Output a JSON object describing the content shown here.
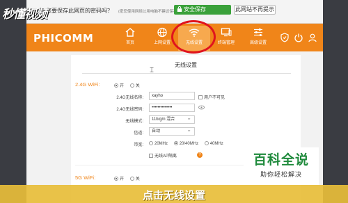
{
  "watermark": {
    "site": "秒懂视频"
  },
  "password_bar": {
    "question": "您要保存此网页的密码吗？",
    "note": "(密您使用网络公用电脑不建议保存)",
    "save_label": "安全保存",
    "never_label": "此网站不再提示"
  },
  "header": {
    "logo": "PHICOMM",
    "nav": [
      {
        "label": "首页",
        "icon": "home-icon"
      },
      {
        "label": "上网设置",
        "icon": "globe-icon"
      },
      {
        "label": "无线设置",
        "icon": "wifi-icon",
        "active": true
      },
      {
        "label": "终端管理",
        "icon": "monitor-icon"
      },
      {
        "label": "高级设置",
        "icon": "sliders-icon"
      }
    ],
    "right_icons": [
      "shield-icon",
      "power-icon",
      "user-icon"
    ],
    "accent": "#f08519",
    "highlight": "#e0141e"
  },
  "panel": {
    "title": "无线设置",
    "wifi24": {
      "section_label": "2.4G WiFi:",
      "on_label": "开",
      "off_label": "关",
      "selected": "on",
      "fields": {
        "name_label": "2.4G无线名称:",
        "name_value": "xayho",
        "hide_label": "用户不可见",
        "password_label": "2.4G无线密码:",
        "password_value": "••••••••••••••",
        "mode_label": "无线模式:",
        "mode_value": "11b/g/n 混合",
        "channel_label": "信道:",
        "channel_value": "自动",
        "bandwidth_label": "带宽:",
        "bandwidth_options": [
          "20MHz",
          "20/40MHz",
          "40MHz"
        ],
        "bandwidth_selected": "20/40MHz",
        "ap_isolation_label": "无线AP隔离"
      }
    },
    "wifi5": {
      "section_label": "5G WiFi:",
      "on_label": "开",
      "off_label": "关",
      "selected": "on"
    }
  },
  "brand": {
    "title": "百科全说",
    "subtitle": "助你轻松解决"
  },
  "caption": "点击无线设置"
}
